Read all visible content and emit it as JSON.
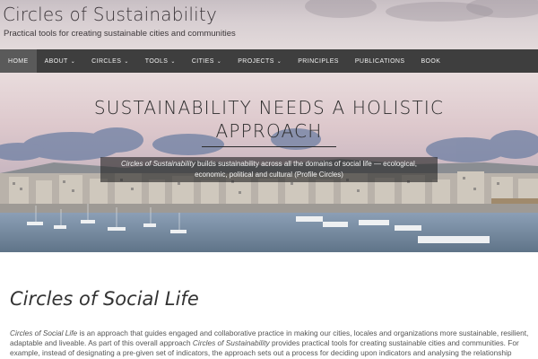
{
  "header": {
    "site_title": "Circles of Sustainability",
    "tagline": "Practical tools for creating sustainable cities and communities"
  },
  "nav": {
    "items": [
      {
        "label": "HOME",
        "active": true,
        "has_dropdown": false
      },
      {
        "label": "ABOUT",
        "active": false,
        "has_dropdown": true
      },
      {
        "label": "CIRCLES",
        "active": false,
        "has_dropdown": true
      },
      {
        "label": "TOOLS",
        "active": false,
        "has_dropdown": true
      },
      {
        "label": "CITIES",
        "active": false,
        "has_dropdown": true
      },
      {
        "label": "PROJECTS",
        "active": false,
        "has_dropdown": true
      },
      {
        "label": "PRINCIPLES",
        "active": false,
        "has_dropdown": false
      },
      {
        "label": "PUBLICATIONS",
        "active": false,
        "has_dropdown": false
      },
      {
        "label": "BOOK",
        "active": false,
        "has_dropdown": false
      }
    ],
    "dropdown_icon": "chevron-down-icon"
  },
  "hero": {
    "heading": "SUSTAINABILITY NEEDS A HOLISTIC APPROACH",
    "caption_emphasis": "Circles of Sustainability",
    "caption_rest": " builds sustainability across all the domains of social life — ecological, economic, political and cultural (Profile Circles)"
  },
  "main": {
    "title": "Circles of Social Life",
    "para_emphasis_1": "Circles of Social Life",
    "para_text_1": " is an approach that guides engaged and collaborative practice in making our cities, locales and organizations more sustainable, resilient, adaptable and liveable. As part of this overall approach ",
    "para_emphasis_2": "Circles of Sustainability",
    "para_text_2": " provides practical tools for creating sustainable cities and communities. For example, instead of designating a pre-given set of indicators, the approach sets out a process for deciding upon indicators and analysing the relationship"
  },
  "colors": {
    "nav_background": "#3e3e3e",
    "nav_active": "#5a5a5a",
    "caption_background": "rgba(35,35,35,0.62)"
  }
}
